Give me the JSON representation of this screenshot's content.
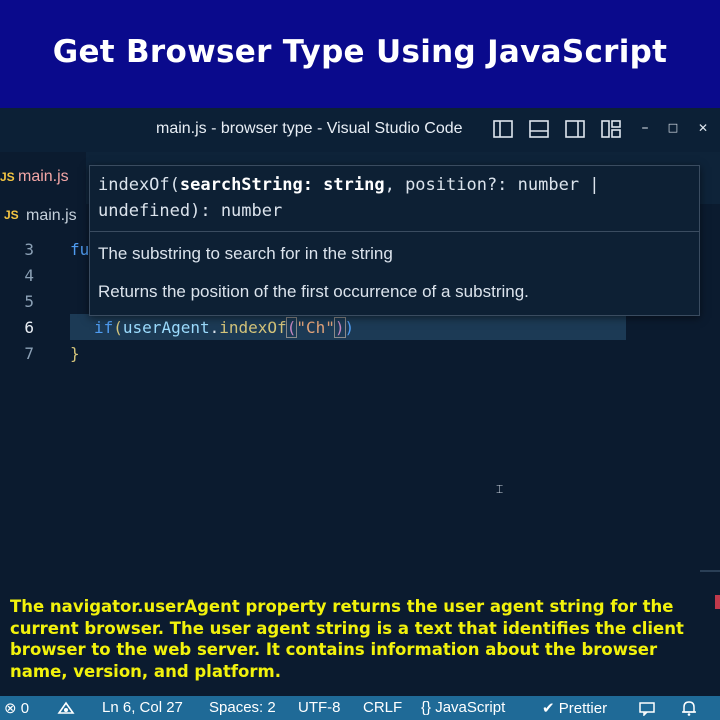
{
  "banner": {
    "title": "Get Browser Type Using JavaScript"
  },
  "window": {
    "title": "main.js - browser type - Visual Studio Code",
    "minimize": "–",
    "maximize": "□",
    "close": "✕"
  },
  "tabs": [
    {
      "label": "main.js",
      "icon": "JS"
    }
  ],
  "breadcrumb": {
    "icon": "JS",
    "file": "main.js"
  },
  "editor": {
    "line_numbers": [
      "3",
      "4",
      "5",
      "6",
      "7"
    ],
    "line3_partial": "fu",
    "line6": {
      "kw": "if",
      "open": "(",
      "obj": "userAgent",
      "dot": ".",
      "method": "indexOf",
      "arg": "\"Ch\"",
      "close": ")"
    },
    "line7": "}"
  },
  "hover": {
    "sig_prefix": "indexOf(",
    "sig_param": "searchString: string",
    "sig_rest": ", position?: number |",
    "sig_line2": "undefined): number",
    "param_doc": "The substring to search for in the string",
    "returns_doc": "Returns the position of the first occurrence of a substring."
  },
  "caption": "The navigator.userAgent property returns the user agent string for the current browser. The user agent string is a text that identifies the client browser to the web server. It contains information about the browser name, version, and platform.",
  "status": {
    "errors": "0",
    "position": "Ln 6, Col 27",
    "spaces": "Spaces: 2",
    "encoding": "UTF-8",
    "eol": "CRLF",
    "language": "JavaScript",
    "formatter": "Prettier"
  }
}
